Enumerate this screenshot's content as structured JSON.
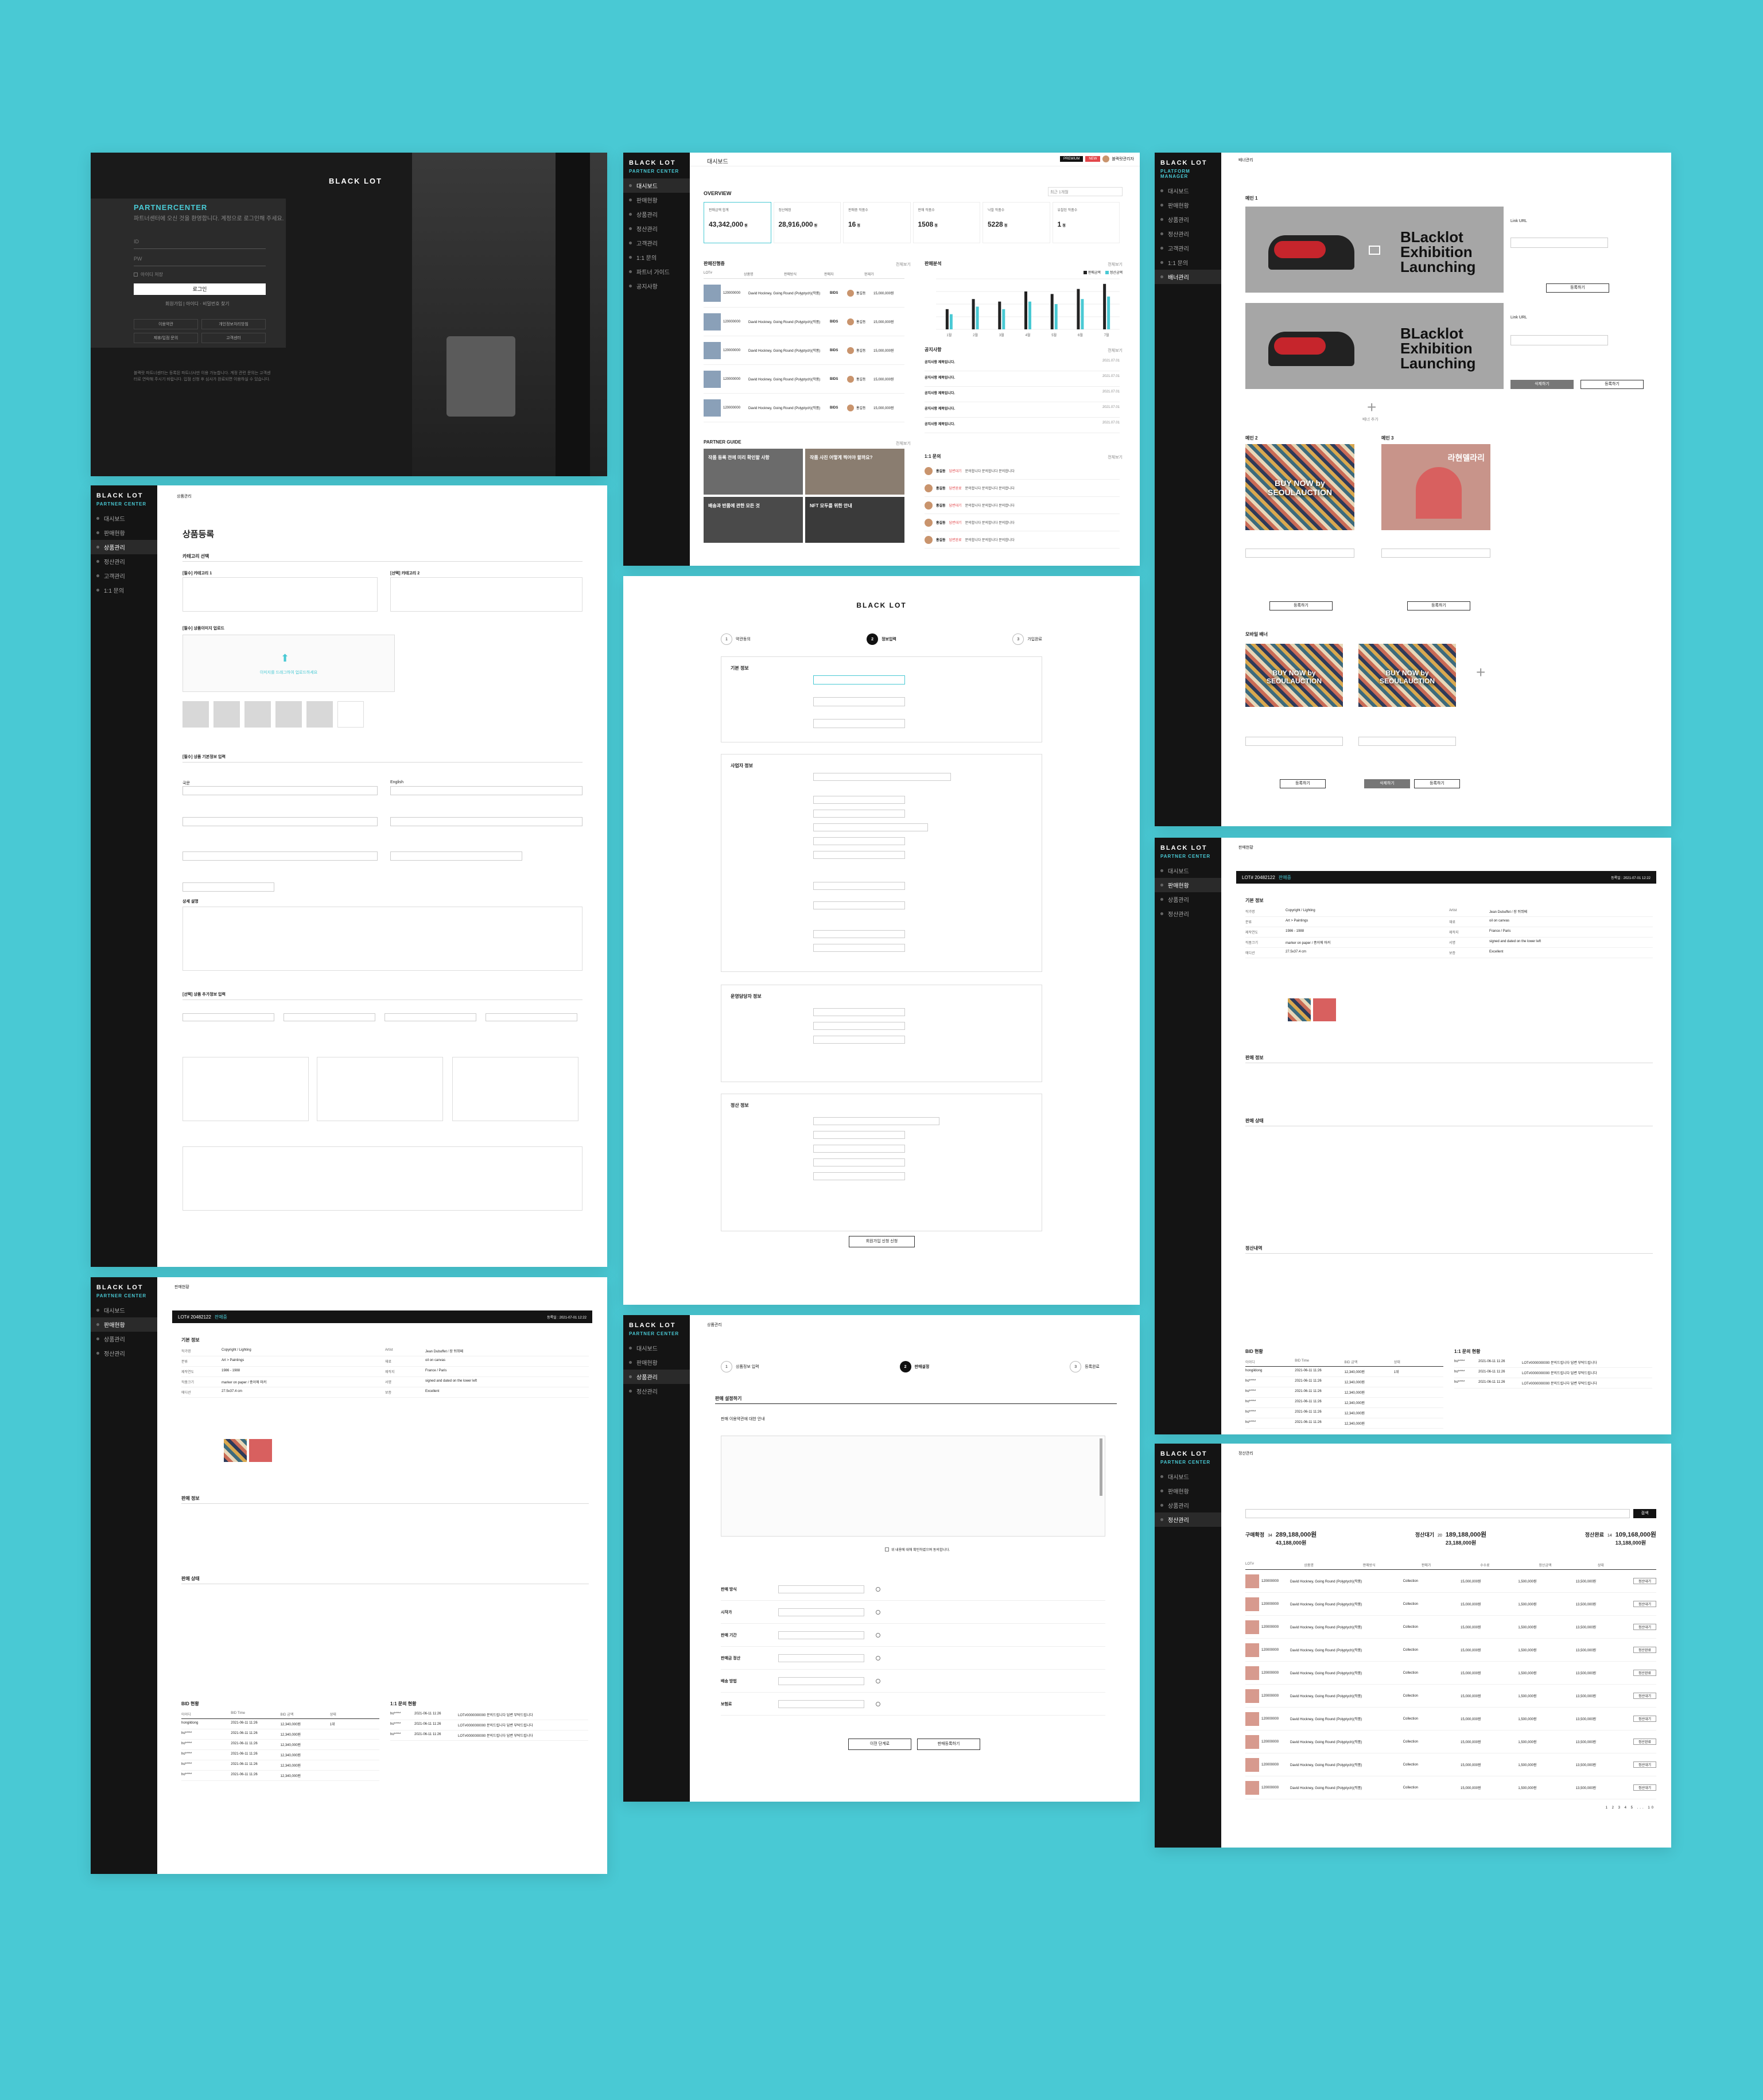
{
  "brand": {
    "logo": "BLACK LOT",
    "partner_center": "PARTNER CENTER",
    "platform_manager": "PLATFORM MANAGER"
  },
  "colors": {
    "background": "#49c9d4",
    "accent": "#49c9d4",
    "sidebar": "#141414",
    "badge_red": "#e2474b"
  },
  "user": {
    "name": "블랙랏관리자",
    "badge_a": "PREMIUM",
    "badge_b": "NEW"
  },
  "login": {
    "title": "PARTNERCENTER",
    "subtitle": "파트너센터에 오신 것을 환영합니다. 계정으로 로그인해 주세요.",
    "id_label": "ID",
    "pw_label": "PW",
    "remember": "아이디 저장",
    "login_btn": "로그인",
    "links": "회원가입 | 아이디 · 비밀번호 찾기",
    "menu": [
      "이용약관",
      "개인정보처리방침",
      "제휴/입점 문의",
      "고객센터"
    ],
    "notice": "블랙랏 파트너센터는 등록된 파트너사만 이용 가능합니다. 계정 관련 문의는 고객센터로 연락해 주시기 바랍니다. 입점 신청 후 심사가 완료되면 이용하실 수 있습니다."
  },
  "sidebar_menu": [
    "대시보드",
    "판매현황",
    "상품관리",
    "정산관리",
    "고객관리",
    "1:1 문의",
    "파트너 가이드",
    "공지사항"
  ],
  "dashboard": {
    "breadcrumb": "대시보드",
    "overview": "OVERVIEW",
    "date_range": "최근 1개월",
    "stats": [
      {
        "label": "판매금액 합계",
        "value": "43,342,000",
        "unit": "원"
      },
      {
        "label": "정산예정",
        "value": "28,916,000",
        "unit": "원"
      },
      {
        "label": "판매중 작품수",
        "value": "16",
        "unit": "점"
      },
      {
        "label": "판매 작품수",
        "value": "1508",
        "unit": "점"
      },
      {
        "label": "낙찰 작품수",
        "value": "5228",
        "unit": "점"
      },
      {
        "label": "유찰된 작품수",
        "value": "1",
        "unit": "점"
      }
    ],
    "sales_title": "판매진행중",
    "sales_headers": [
      "LOT#",
      "상품명",
      "판매방식",
      "판매자",
      "현재가"
    ],
    "sales_rows": [
      {
        "lot": "120000000",
        "name": "David Hockney, Going Round (Polyptych)(작품)",
        "type": "BIDS",
        "seller": "홍길동",
        "price": "15,000,000원"
      },
      {
        "lot": "120000000",
        "name": "David Hockney, Going Round (Polyptych)(작품)",
        "type": "BIDS",
        "seller": "홍길동",
        "price": "15,000,000원"
      },
      {
        "lot": "120000000",
        "name": "David Hockney, Going Round (Polyptych)(작품)",
        "type": "BIDS",
        "seller": "홍길동",
        "price": "15,000,000원"
      },
      {
        "lot": "120000000",
        "name": "David Hockney, Going Round (Polyptych)(작품)",
        "type": "BIDS",
        "seller": "홍길동",
        "price": "15,000,000원"
      },
      {
        "lot": "120000000",
        "name": "David Hockney, Going Round (Polyptych)(작품)",
        "type": "BIDS",
        "seller": "홍길동",
        "price": "15,000,000원"
      }
    ],
    "chart_title": "판매분석",
    "legend": [
      "판매금액",
      "정산금액"
    ],
    "notice_title": "공지사항",
    "notices": [
      {
        "title": "공지사항 제목입니다.",
        "date": "2021.07.01"
      },
      {
        "title": "공지사항 제목입니다.",
        "date": "2021.07.01"
      },
      {
        "title": "공지사항 제목입니다.",
        "date": "2021.07.01"
      },
      {
        "title": "공지사항 제목입니다.",
        "date": "2021.07.01"
      },
      {
        "title": "공지사항 제목입니다.",
        "date": "2021.07.01"
      }
    ],
    "guide_title": "PARTNER GUIDE",
    "guides": [
      "작품 등록 전에 미리 확인할 사항",
      "작품 사진 어떻게 찍어야 할까요?",
      "배송과 반품에 관한 모든 것",
      "NFT 모두를 위한 안내"
    ],
    "qna_title": "1:1 문의",
    "qna": [
      {
        "user": "홍길동",
        "status": "답변대기",
        "text": "문의합니다 문의합니다 문의합니다"
      },
      {
        "user": "홍길동",
        "status": "답변완료",
        "text": "문의합니다 문의합니다 문의합니다"
      },
      {
        "user": "홍길동",
        "status": "답변대기",
        "text": "문의합니다 문의합니다 문의합니다"
      },
      {
        "user": "홍길동",
        "status": "답변대기",
        "text": "문의합니다 문의합니다 문의합니다"
      },
      {
        "user": "홍길동",
        "status": "답변완료",
        "text": "문의합니다 문의합니다 문의합니다"
      }
    ],
    "more": "전체보기"
  },
  "chart_data": {
    "type": "bar",
    "categories": [
      "1월",
      "2월",
      "3월",
      "4월",
      "5월",
      "6월",
      "7월"
    ],
    "series": [
      {
        "name": "판매금액",
        "values": [
          40,
          60,
          55,
          75,
          70,
          80,
          90
        ]
      },
      {
        "name": "정산금액",
        "values": [
          30,
          45,
          40,
          55,
          50,
          60,
          65
        ]
      }
    ],
    "ylim": [
      0,
      100
    ]
  },
  "banner": {
    "breadcrumb": "배너관리",
    "main_title": "메인 1",
    "banner_text": "BLacklot Exhibition Launching",
    "link_label": "Link URL",
    "add": "배너 추가",
    "save": "등록하기",
    "delete": "삭제하기",
    "sub2": "메인 2",
    "sub3": "메인 3",
    "sub2_text": "BUY NOW by SEOULAUCTION",
    "sub3_text": "라현델라리",
    "mobile_title": "모바일 배너",
    "mobile_text": "BUY NOW by SEOULAUCTION"
  },
  "product": {
    "breadcrumb": "상품관리",
    "title": "상품등록",
    "category": "카테고리 선택",
    "cat1": "[필수] 카테고리 1",
    "cat2": "[선택] 카테고리 2",
    "image": "[필수] 상품이미지 업로드",
    "upload_hint": "이미지를 드래그하여 업로드하세요",
    "basic": "[필수] 상품 기본정보 입력",
    "korean": "국문",
    "english": "English",
    "detail": "상세 설명",
    "extra": "[선택] 상품 추가정보 입력"
  },
  "signup": {
    "logo": "BLACK LOT",
    "steps": [
      "약관동의",
      "정보입력",
      "가입완료"
    ],
    "basic": "기본 정보",
    "business": "사업자 정보",
    "manager": "운영담당자 정보",
    "settlement": "정산 정보",
    "submit": "회원가입 신청 신청"
  },
  "lot_detail": {
    "breadcrumb": "판매현황",
    "lot": "LOT# 20482122",
    "status": "판매중",
    "date": "등록일 : 2021-07-01 12:22",
    "basic": "기본 정보",
    "sale": "판매 정보",
    "state": "판매 상태",
    "settle": "정산내역",
    "bid": "BID 현황",
    "qna": "1:1 문의 현황",
    "fields": [
      {
        "k": "작가명",
        "v": "Copyright / Lighting",
        "k2": "Artist",
        "v2": "Jean Dubuffet / 장 뒤뷔페"
      },
      {
        "k": "분류",
        "v": "Art > Paintings",
        "k2": "재료",
        "v2": "oil on canvas"
      },
      {
        "k": "제작연도",
        "v": "1986 - 1988",
        "k2": "제작지",
        "v2": "France / Paris"
      },
      {
        "k": "작품크기",
        "v": "marker on paper / 종이에 마커",
        "k2": "서명",
        "v2": "signed and dated on the lower left"
      },
      {
        "k": "에디션",
        "v": "27.5x37.4 cm",
        "k2": "보증",
        "v2": "Excellent"
      }
    ],
    "sale_rows": [
      "Data Name",
      "Data Name",
      "Data Name",
      "Data Name"
    ],
    "bid_headers": [
      "아이디",
      "BID Time",
      "BID 금액",
      "상태"
    ],
    "bid_rows": [
      {
        "id": "hongildong",
        "time": "2021-06-11 11:26",
        "price": "12,340,000원",
        "state": "1위"
      },
      {
        "id": "ho*****",
        "time": "2021-06-11 11:26",
        "price": "12,340,000원",
        "state": ""
      },
      {
        "id": "ho*****",
        "time": "2021-06-11 11:26",
        "price": "12,340,000원",
        "state": ""
      },
      {
        "id": "ho*****",
        "time": "2021-06-11 11:26",
        "price": "12,340,000원",
        "state": ""
      },
      {
        "id": "ho*****",
        "time": "2021-06-11 11:26",
        "price": "12,340,000원",
        "state": ""
      },
      {
        "id": "ho*****",
        "time": "2021-06-11 11:26",
        "price": "12,340,000원",
        "state": ""
      }
    ],
    "qna_rows": [
      {
        "id": "ho*****",
        "time": "2021-06-11 11:26",
        "text": "LOT#0000000000 문의드립니다 답변 부탁드립니다"
      },
      {
        "id": "ho*****",
        "time": "2021-06-11 11:26",
        "text": "LOT#0000000000 문의드립니다 답변 부탁드립니다"
      },
      {
        "id": "ho*****",
        "time": "2021-06-11 11:26",
        "text": "LOT#0000000000 문의드립니다 답변 부탁드립니다"
      }
    ]
  },
  "sales_setup": {
    "breadcrumb": "상품관리",
    "steps": [
      "상품정보 입력",
      "판매설정",
      "등록완료"
    ],
    "title": "판매 설정하기",
    "terms": "판매 이용약관에 대한 안내",
    "agree": "위 내용에 대해 확인하였으며 동의합니다.",
    "options": [
      "판매 방식",
      "시작가",
      "판매 기간",
      "판매금 정산",
      "배송 방법",
      "보험료"
    ],
    "prev": "이전 단계로",
    "next": "판매등록하기"
  },
  "settlement": {
    "breadcrumb": "정산관리",
    "summary": [
      {
        "label": "구매확정",
        "count": "34",
        "total": "289,188,000",
        "unit": "원",
        "sub": "43,188,000"
      },
      {
        "label": "정산대기",
        "count": "20",
        "total": "189,188,000",
        "unit": "원",
        "sub": "23,188,000"
      },
      {
        "label": "정산완료",
        "count": "14",
        "total": "109,168,000",
        "unit": "원",
        "sub": "13,188,000"
      }
    ],
    "search": "검색",
    "headers": [
      "LOT#",
      "상품명",
      "판매방식",
      "판매가",
      "수수료",
      "정산금액",
      "상태"
    ],
    "rows": [
      {
        "lot": "120000000",
        "name": "David Hockney, Going Round (Polyptych)(작품)",
        "type": "Collection",
        "price": "15,000,000원",
        "fee": "1,500,000원",
        "settle": "13,500,000원",
        "state": "정산대기"
      },
      {
        "lot": "120000000",
        "name": "David Hockney, Going Round (Polyptych)(작품)",
        "type": "Collection",
        "price": "15,000,000원",
        "fee": "1,500,000원",
        "settle": "13,500,000원",
        "state": "정산대기"
      },
      {
        "lot": "120000000",
        "name": "David Hockney, Going Round (Polyptych)(작품)",
        "type": "Collection",
        "price": "15,000,000원",
        "fee": "1,500,000원",
        "settle": "13,500,000원",
        "state": "정산대기"
      },
      {
        "lot": "120000000",
        "name": "David Hockney, Going Round (Polyptych)(작품)",
        "type": "Collection",
        "price": "15,000,000원",
        "fee": "1,500,000원",
        "settle": "13,500,000원",
        "state": "정산완료"
      },
      {
        "lot": "120000000",
        "name": "David Hockney, Going Round (Polyptych)(작품)",
        "type": "Collection",
        "price": "15,000,000원",
        "fee": "1,500,000원",
        "settle": "13,500,000원",
        "state": "정산완료"
      },
      {
        "lot": "120000000",
        "name": "David Hockney, Going Round (Polyptych)(작품)",
        "type": "Collection",
        "price": "15,000,000원",
        "fee": "1,500,000원",
        "settle": "13,500,000원",
        "state": "정산대기"
      },
      {
        "lot": "120000000",
        "name": "David Hockney, Going Round (Polyptych)(작품)",
        "type": "Collection",
        "price": "15,000,000원",
        "fee": "1,500,000원",
        "settle": "13,500,000원",
        "state": "정산대기"
      },
      {
        "lot": "120000000",
        "name": "David Hockney, Going Round (Polyptych)(작품)",
        "type": "Collection",
        "price": "15,000,000원",
        "fee": "1,500,000원",
        "settle": "13,500,000원",
        "state": "정산완료"
      },
      {
        "lot": "120000000",
        "name": "David Hockney, Going Round (Polyptych)(작품)",
        "type": "Collection",
        "price": "15,000,000원",
        "fee": "1,500,000원",
        "settle": "13,500,000원",
        "state": "정산대기"
      },
      {
        "lot": "120000000",
        "name": "David Hockney, Going Round (Polyptych)(작품)",
        "type": "Collection",
        "price": "15,000,000원",
        "fee": "1,500,000원",
        "settle": "13,500,000원",
        "state": "정산대기"
      }
    ],
    "pagination": "1 2 3 4 5 ... 10"
  }
}
